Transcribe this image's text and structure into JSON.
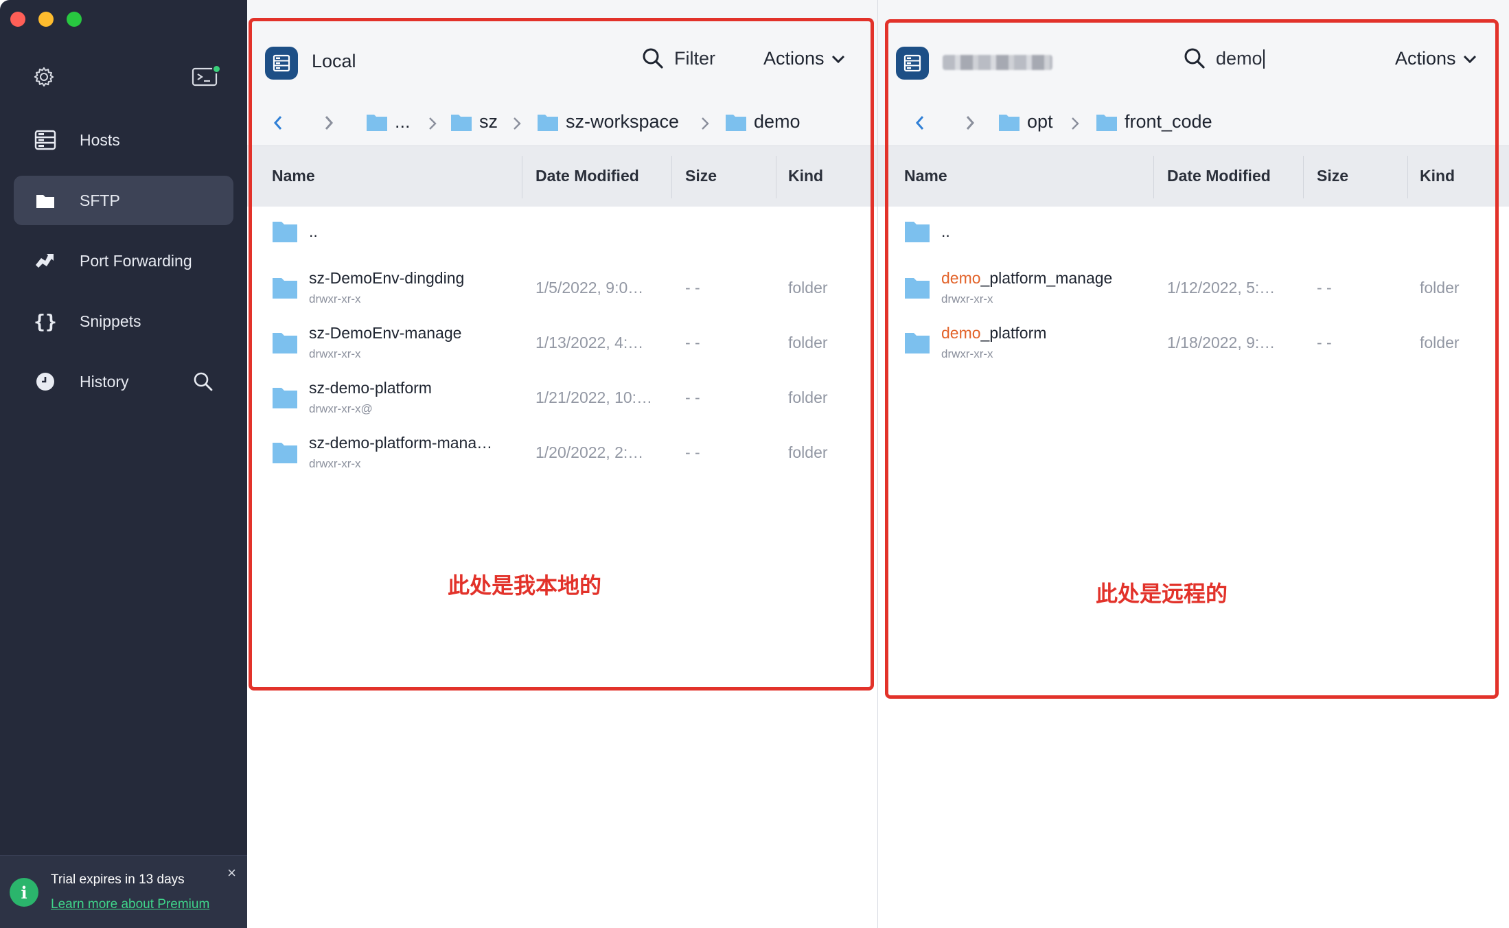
{
  "sidebar": {
    "items": [
      {
        "label": "Hosts",
        "icon": "hosts-icon",
        "active": false
      },
      {
        "label": "SFTP",
        "icon": "folder-icon",
        "active": true
      },
      {
        "label": "Port Forwarding",
        "icon": "port-forwarding-icon",
        "active": false
      },
      {
        "label": "Snippets",
        "icon": "snippets-icon",
        "active": false
      },
      {
        "label": "History",
        "icon": "history-icon",
        "active": false
      }
    ],
    "trial": {
      "title": "Trial expires in 13 days",
      "link": "Learn more about Premium",
      "close": "×"
    }
  },
  "colors": {
    "sidebar_bg": "#252a3a",
    "active_item": "#3d4356",
    "accent_green": "#2bb56c",
    "highlight": "#e2632a",
    "annotation": "#e2322a",
    "host_badge": "#1d4f86",
    "folder": "#7cc0ee"
  },
  "local": {
    "host_name": "Local",
    "search_label": "Filter",
    "actions_label": "Actions",
    "breadcrumb": [
      "...",
      "sz",
      "sz-workspace",
      "demo"
    ],
    "columns": [
      "Name",
      "Date Modified",
      "Size",
      "Kind"
    ],
    "rows": [
      {
        "name": "..",
        "perm": "",
        "date": "",
        "size": "",
        "kind": ""
      },
      {
        "name": "sz-DemoEnv-dingding",
        "perm": "drwxr-xr-x",
        "date": "1/5/2022, 9:0…",
        "size": "- -",
        "kind": "folder"
      },
      {
        "name": "sz-DemoEnv-manage",
        "perm": "drwxr-xr-x",
        "date": "1/13/2022, 4:…",
        "size": "- -",
        "kind": "folder"
      },
      {
        "name": "sz-demo-platform",
        "perm": "drwxr-xr-x@",
        "date": "1/21/2022, 10:…",
        "size": "- -",
        "kind": "folder"
      },
      {
        "name": "sz-demo-platform-mana…",
        "perm": "drwxr-xr-x",
        "date": "1/20/2022, 2:…",
        "size": "- -",
        "kind": "folder"
      }
    ],
    "annotation": "此处是我本地的"
  },
  "remote": {
    "search_value": "demo",
    "actions_label": "Actions",
    "breadcrumb": [
      "opt",
      "front_code"
    ],
    "columns": [
      "Name",
      "Date Modified",
      "Size",
      "Kind"
    ],
    "rows": [
      {
        "name": "..",
        "perm": "",
        "date": "",
        "size": "",
        "kind": ""
      },
      {
        "name_hl": "demo",
        "name_rest": "_platform_manage",
        "perm": "drwxr-xr-x",
        "date": "1/12/2022, 5:…",
        "size": "- -",
        "kind": "folder"
      },
      {
        "name_hl": "demo",
        "name_rest": "_platform",
        "perm": "drwxr-xr-x",
        "date": "1/18/2022, 9:…",
        "size": "- -",
        "kind": "folder"
      }
    ],
    "annotation": "此处是远程的"
  }
}
